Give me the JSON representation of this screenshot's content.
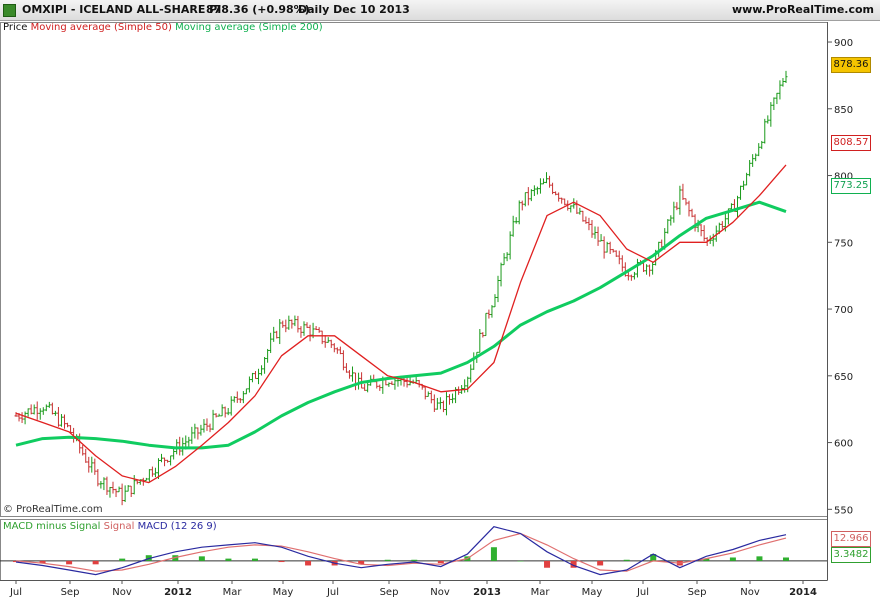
{
  "header": {
    "symbol": "OMXIPI - ICELAND ALL-SHARE PI",
    "quote": "878.36 (+0.98%)",
    "period": "Daily  Dec 10 2013",
    "site": "www.ProRealTime.com"
  },
  "legend": {
    "price": "Price",
    "sma50": "Moving average (Simple 50)",
    "sma200": "Moving average (Simple 200)"
  },
  "watermark": "© ProRealTime.com",
  "macd_legend": {
    "hist": "MACD minus Signal",
    "signal": "Signal",
    "macd": "MACD (12 26 9)"
  },
  "tags": {
    "price": "878.36",
    "sma50": "808.57",
    "sma200": "773.25",
    "signal": "12.966",
    "hist": "3.3482"
  },
  "colors": {
    "price_up": "#1a9a1a",
    "price_down": "#c83232",
    "sma50": "#e02020",
    "sma200": "#10cc60",
    "macd": "#2a2aa0",
    "signal": "#e07070",
    "hist_pos": "#30b030",
    "hist_neg": "#e04040",
    "price_tag_bg": "#f5c400"
  },
  "chart_data": {
    "type": "line",
    "title": "OMXIPI - ICELAND ALL-SHARE PI",
    "ylim": [
      545,
      915
    ],
    "y_ticks": [
      550,
      600,
      650,
      700,
      750,
      800,
      850,
      900
    ],
    "x_ticks": [
      "Jul",
      "Sep",
      "Nov",
      "2012",
      "Mar",
      "May",
      "Jul",
      "Sep",
      "Nov",
      "2013",
      "Mar",
      "May",
      "Jul",
      "Sep",
      "Nov",
      "2014"
    ],
    "x": [
      "2011-07",
      "2011-08",
      "2011-09",
      "2011-10",
      "2011-11",
      "2011-12",
      "2012-01",
      "2012-02",
      "2012-03",
      "2012-04",
      "2012-05",
      "2012-06",
      "2012-07",
      "2012-08",
      "2012-09",
      "2012-10",
      "2012-11",
      "2012-12",
      "2013-01",
      "2013-02",
      "2013-03",
      "2013-04",
      "2013-05",
      "2013-06",
      "2013-07",
      "2013-08",
      "2013-09",
      "2013-10",
      "2013-11",
      "2013-12"
    ],
    "series": [
      {
        "name": "Price",
        "values": [
          620,
          628,
          610,
          575,
          560,
          578,
          595,
          610,
          625,
          650,
          690,
          685,
          672,
          640,
          648,
          645,
          625,
          650,
          710,
          780,
          795,
          775,
          750,
          728,
          735,
          785,
          750,
          775,
          825,
          878
        ]
      },
      {
        "name": "Moving average (Simple 50)",
        "values": [
          622,
          615,
          608,
          590,
          575,
          570,
          582,
          598,
          615,
          635,
          665,
          680,
          680,
          665,
          650,
          645,
          638,
          640,
          660,
          720,
          770,
          780,
          770,
          745,
          735,
          750,
          750,
          765,
          785,
          808
        ]
      },
      {
        "name": "Moving average (Simple 200)",
        "values": [
          598,
          603,
          604,
          603,
          601,
          598,
          596,
          596,
          598,
          608,
          620,
          630,
          638,
          645,
          648,
          650,
          652,
          660,
          672,
          688,
          698,
          706,
          716,
          728,
          740,
          755,
          768,
          774,
          780,
          773
        ]
      }
    ],
    "macd": {
      "name": "MACD (12 26 9)",
      "values": [
        -1,
        -4,
        -8,
        -12,
        -6,
        2,
        8,
        12,
        14,
        16,
        12,
        4,
        -2,
        -6,
        -3,
        -1,
        -5,
        6,
        30,
        24,
        8,
        -4,
        -12,
        -8,
        6,
        -6,
        4,
        10,
        18,
        23
      ]
    },
    "signal": {
      "name": "Signal",
      "values": [
        0,
        -2,
        -5,
        -9,
        -8,
        -3,
        3,
        8,
        12,
        14,
        13,
        8,
        2,
        -3,
        -4,
        -2,
        -3,
        2,
        18,
        24,
        14,
        2,
        -8,
        -9,
        0,
        -2,
        2,
        7,
        14,
        20
      ]
    },
    "histogram": {
      "name": "MACD minus Signal",
      "values": [
        -1,
        -2,
        -3,
        -3,
        2,
        5,
        5,
        4,
        2,
        2,
        -1,
        -4,
        -4,
        -3,
        1,
        1,
        -2,
        4,
        12,
        0,
        -6,
        -6,
        -4,
        1,
        6,
        -4,
        2,
        3,
        4,
        3
      ]
    }
  }
}
